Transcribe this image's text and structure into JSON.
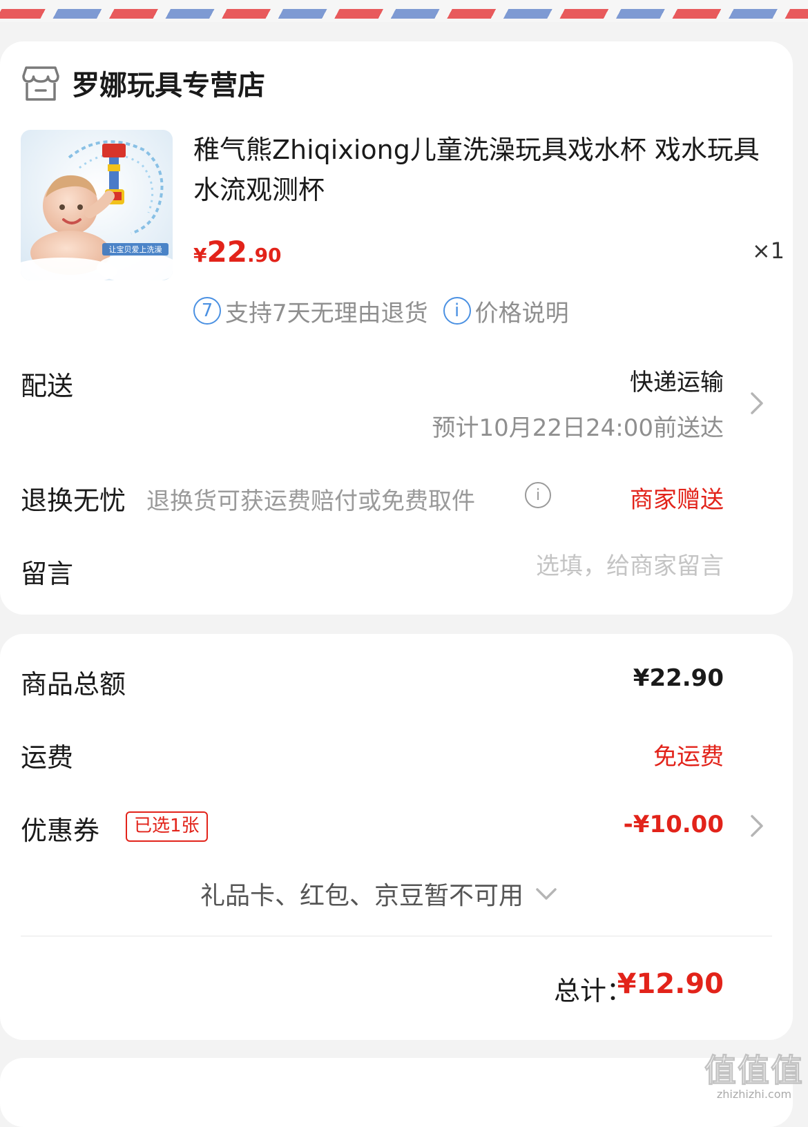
{
  "store": {
    "icon": "store-icon",
    "name": "罗娜玩具专营店"
  },
  "product": {
    "image": "bath-toy-product-image",
    "image_caption": "让宝贝爱上洗澡",
    "title": "稚气熊Zhiqixiong儿童洗澡玩具戏水杯 戏水玩具 水流观测杯",
    "price_currency": "¥",
    "price_integer": "22",
    "price_decimal": ".90",
    "quantity": "×1",
    "service_return": "支持7天无理由退货",
    "service_return_icon": "7",
    "service_price_note": "价格说明",
    "service_price_icon": "i"
  },
  "delivery": {
    "label": "配送",
    "method": "快递运输",
    "eta": "预计10月22日24:00前送达"
  },
  "returns": {
    "label": "退换无忧",
    "desc": "退换货可获运费赔付或免费取件",
    "info_icon": "i",
    "badge": "商家赠送"
  },
  "message": {
    "label": "留言",
    "placeholder": "选填，给商家留言"
  },
  "summary": {
    "subtotal_label": "商品总额",
    "subtotal_value": "¥22.90",
    "shipping_label": "运费",
    "shipping_value": "免运费",
    "coupon_label": "优惠券",
    "coupon_badge": "已选1张",
    "coupon_value": "-¥10.00",
    "giftcard_note": "礼品卡、红包、京豆暂不可用",
    "total_label": "总计：",
    "total_value": "¥12.90"
  },
  "watermark": {
    "logo": "值值值",
    "site": "zhizhizhi.com"
  },
  "colors": {
    "accent_red": "#e2231a",
    "info_blue": "#4a90e2",
    "airmail_red": "#e85a5c",
    "airmail_blue": "#7e9ad3"
  }
}
